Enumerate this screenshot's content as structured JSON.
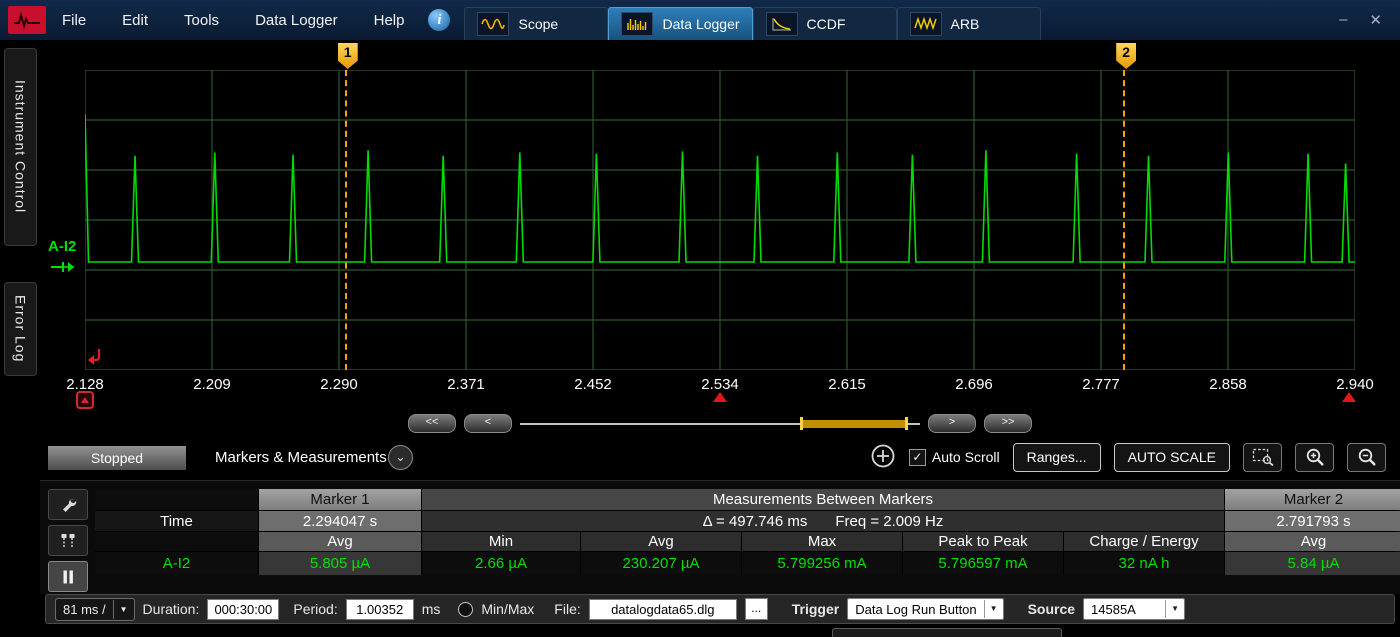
{
  "titlebar": {
    "menu": [
      {
        "label": "File"
      },
      {
        "label": "Edit"
      },
      {
        "label": "Tools"
      },
      {
        "label": "Data Logger"
      },
      {
        "label": "Help"
      }
    ],
    "tabs": [
      {
        "label": "Scope"
      },
      {
        "label": "Data Logger",
        "active": true
      },
      {
        "label": "CCDF"
      },
      {
        "label": "ARB"
      }
    ],
    "minimize": "–",
    "close": "✕"
  },
  "sidebar": {
    "instrument_control": "Instrument Control",
    "error_log": "Error Log"
  },
  "chart_data": {
    "type": "line",
    "trace": "A-I2",
    "trace_color": "#00dc00",
    "x_unit": "s",
    "x_range": [
      2.128,
      2.94
    ],
    "x_ticks": [
      "2.128",
      "2.209",
      "2.290",
      "2.371",
      "2.452",
      "2.534",
      "2.615",
      "2.696",
      "2.777",
      "2.858",
      "2.940"
    ],
    "y_info": "current: baseline ~0 A with periodic pulses peaking ~5.8 mA (y axis unlabeled)",
    "baseline_frac": 0.64,
    "grid": {
      "cols": 10,
      "rows": 6
    },
    "spikes": [
      {
        "t": 2.128,
        "a": 1.35
      },
      {
        "t": 2.16,
        "a": 0.97
      },
      {
        "t": 2.211,
        "a": 1.0
      },
      {
        "t": 2.261,
        "a": 0.98
      },
      {
        "t": 2.309,
        "a": 1.02
      },
      {
        "t": 2.357,
        "a": 0.97
      },
      {
        "t": 2.406,
        "a": 1.0
      },
      {
        "t": 2.455,
        "a": 0.99
      },
      {
        "t": 2.51,
        "a": 1.01
      },
      {
        "t": 2.558,
        "a": 0.97
      },
      {
        "t": 2.609,
        "a": 1.0
      },
      {
        "t": 2.657,
        "a": 0.98
      },
      {
        "t": 2.704,
        "a": 1.02
      },
      {
        "t": 2.762,
        "a": 0.99
      },
      {
        "t": 2.808,
        "a": 0.97
      },
      {
        "t": 2.859,
        "a": 1.0
      },
      {
        "t": 2.91,
        "a": 0.99
      },
      {
        "t": 2.934,
        "a": 0.9
      }
    ],
    "markers": [
      {
        "id": "1",
        "t": 2.294047
      },
      {
        "id": "2",
        "t": 2.791793
      }
    ],
    "event_marks_s": [
      2.534,
      2.936
    ],
    "legend_position": "left"
  },
  "nav": {
    "first": "<<",
    "prev": "<",
    "next": ">",
    "last": ">>"
  },
  "toolbar": {
    "run_state": "Stopped",
    "panel_selector": "Markers & Measurements",
    "autoscroll_label": "Auto Scroll",
    "autoscroll_checked": true,
    "ranges_label": "Ranges...",
    "autoscale_label": "AUTO SCALE"
  },
  "measurements": {
    "marker1_header": "Marker 1",
    "between_header": "Measurements Between Markers",
    "marker2_header": "Marker 2",
    "time_label": "Time",
    "marker1_time": "2.294047 s",
    "delta": "Δ = 497.746 ms",
    "freq": "Freq = 2.009 Hz",
    "marker2_time": "2.791793 s",
    "col_avg1": "Avg",
    "col_min": "Min",
    "col_avg": "Avg",
    "col_max": "Max",
    "col_p2p": "Peak to Peak",
    "col_charge": "Charge / Energy",
    "col_avg2": "Avg",
    "row_label": "A-I2",
    "marker1_avg": "5.805 µA",
    "min": "2.66 µA",
    "avg": "230.207 µA",
    "max": "5.799256 mA",
    "p2p": "5.796597 mA",
    "charge": "32 nA h",
    "marker2_avg": "5.84 µA"
  },
  "bottombar": {
    "timebase": "81 ms /",
    "duration_label": "Duration:",
    "duration_value": "000:30:00",
    "period_label": "Period:",
    "period_value": "1.00352",
    "period_unit": "ms",
    "minmax_label": "Min/Max",
    "minmax_checked": false,
    "file_label": "File:",
    "file_value": "datalogdata65.dlg",
    "browse_label": "...",
    "trigger_label": "Trigger",
    "trigger_value": "Data Log Run Button",
    "source_label": "Source",
    "source_value": "14585A"
  }
}
